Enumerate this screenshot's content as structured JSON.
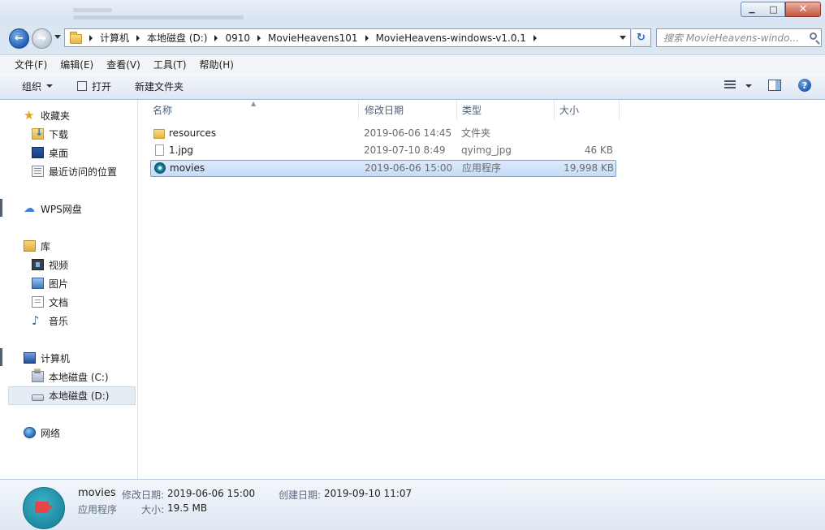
{
  "window": {
    "minimize": "▁",
    "maximize": "□",
    "close": "✕"
  },
  "nav": {
    "back": "←",
    "forward": "→",
    "refresh": "↻",
    "breadcrumb": [
      "计算机",
      "本地磁盘 (D:)",
      "0910",
      "MovieHeavens101",
      "MovieHeavens-windows-v1.0.1"
    ],
    "search_placeholder": "搜索 MovieHeavens-windo..."
  },
  "menubar": [
    "文件(F)",
    "编辑(E)",
    "查看(V)",
    "工具(T)",
    "帮助(H)"
  ],
  "toolbar": {
    "organize": "组织",
    "open": "打开",
    "new_folder": "新建文件夹",
    "help": "?"
  },
  "sidebar": {
    "favorites": "收藏夹",
    "favorites_items": [
      "下载",
      "桌面",
      "最近访问的位置"
    ],
    "wps": "WPS网盘",
    "libraries": "库",
    "library_items": [
      "视频",
      "图片",
      "文档",
      "音乐"
    ],
    "computer": "计算机",
    "drives": [
      "本地磁盘 (C:)",
      "本地磁盘 (D:)"
    ],
    "network": "网络"
  },
  "columns": {
    "name": "名称",
    "date": "修改日期",
    "type": "类型",
    "size": "大小"
  },
  "files": [
    {
      "name": "resources",
      "date": "2019-06-06 14:45",
      "type": "文件夹",
      "size": "",
      "icon": "folder-icon"
    },
    {
      "name": "1.jpg",
      "date": "2019-07-10 8:49",
      "type": "qyimg_jpg",
      "size": "46 KB",
      "icon": "file-icon"
    },
    {
      "name": "movies",
      "date": "2019-06-06 15:00",
      "type": "应用程序",
      "size": "19,998 KB",
      "icon": "app-icon"
    }
  ],
  "details": {
    "name": "movies",
    "type": "应用程序",
    "modified_label": "修改日期:",
    "modified": "2019-06-06 15:00",
    "created_label": "创建日期:",
    "created": "2019-09-10 11:07",
    "size_label": "大小:",
    "size": "19.5 MB"
  }
}
